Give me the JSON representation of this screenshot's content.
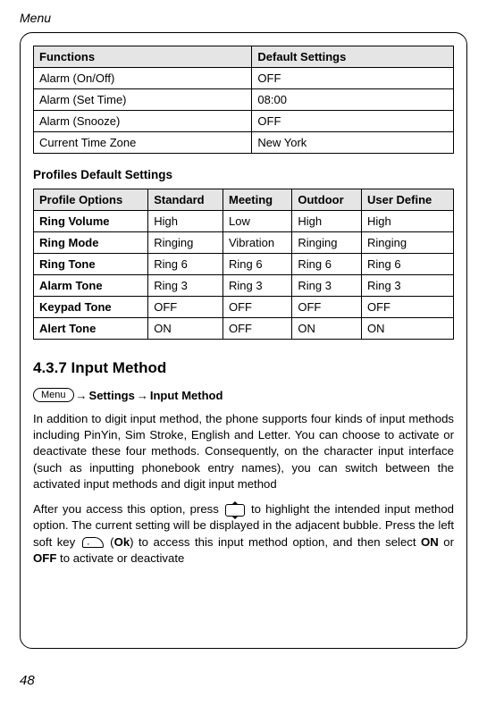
{
  "header": "Menu",
  "table1": {
    "headers": [
      "Functions",
      "Default Settings"
    ],
    "rows": [
      [
        "Alarm (On/Off)",
        "OFF"
      ],
      [
        "Alarm (Set Time)",
        "08:00"
      ],
      [
        "Alarm (Snooze)",
        "OFF"
      ],
      [
        "Current Time Zone",
        "New York"
      ]
    ]
  },
  "profiles_heading": "Profiles Default Settings",
  "table2": {
    "headers": [
      "Profile Options",
      "Standard",
      "Meeting",
      "Outdoor",
      "User Define"
    ],
    "rows": [
      [
        "Ring Volume",
        "High",
        "Low",
        "High",
        "High"
      ],
      [
        "Ring Mode",
        "Ringing",
        "Vibration",
        "Ringing",
        "Ringing"
      ],
      [
        "Ring Tone",
        "Ring 6",
        "Ring 6",
        "Ring 6",
        "Ring 6"
      ],
      [
        "Alarm Tone",
        "Ring 3",
        "Ring 3",
        "Ring 3",
        "Ring 3"
      ],
      [
        "Keypad Tone",
        "OFF",
        "OFF",
        "OFF",
        "OFF"
      ],
      [
        "Alert Tone",
        "ON",
        "OFF",
        "ON",
        "ON"
      ]
    ]
  },
  "section_number": "4.3.7 Input Method",
  "breadcrumb": {
    "menu_label": "Menu",
    "arrow1": "→",
    "step1": "Settings",
    "arrow2": "→",
    "step2": "Input Method"
  },
  "para1": "In addition to digit input method, the phone supports four kinds of input methods including PinYin, Sim Stroke, English and Letter. You can choose to activate or deactivate these four methods. Consequently, on the character input interface (such as inputting phonebook entry names), you can switch between the activated input methods and digit input method",
  "para2_a": "After you access this option, press ",
  "para2_b": " to highlight the intended input method option. The current setting will be displayed in the adjacent bubble. Press the left soft key ",
  "para2_c": " (",
  "para2_ok": "Ok",
  "para2_d": ") to access this input method option, and then select ",
  "para2_on": "ON",
  "para2_or": " or ",
  "para2_off": "OFF",
  "para2_e": " to activate or deactivate",
  "page_number": "48"
}
